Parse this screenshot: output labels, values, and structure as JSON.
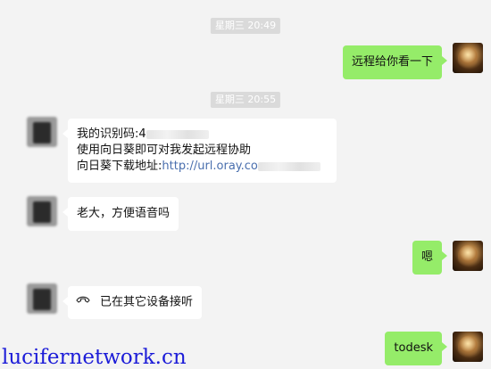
{
  "messages": [
    {
      "type": "timestamp",
      "text": "星期三 20:49"
    },
    {
      "type": "outgoing",
      "text": "远程给你看一下"
    },
    {
      "type": "timestamp",
      "text": "星期三 20:55"
    },
    {
      "type": "incoming",
      "lines": {
        "l1_prefix": "我的识别码:",
        "l1_visible": "4",
        "l2": "使用向日葵即可对我发起远程协助",
        "l3_prefix": "向日葵下载地址:",
        "l3_link": "http://url.oray.co"
      }
    },
    {
      "type": "incoming",
      "text": "老大，方便语音吗"
    },
    {
      "type": "outgoing",
      "text": "嗯"
    },
    {
      "type": "incoming",
      "icon": "phone-hangup-icon",
      "text": "已在其它设备接听"
    },
    {
      "type": "outgoing",
      "text": "todesk"
    }
  ],
  "watermark": "lucifernetwork.cn",
  "colors": {
    "outgoing_bubble": "#95ec69",
    "incoming_bubble": "#ffffff",
    "background": "#f3f3f3",
    "link": "#4a6fae",
    "watermark": "#1c1cd8"
  }
}
